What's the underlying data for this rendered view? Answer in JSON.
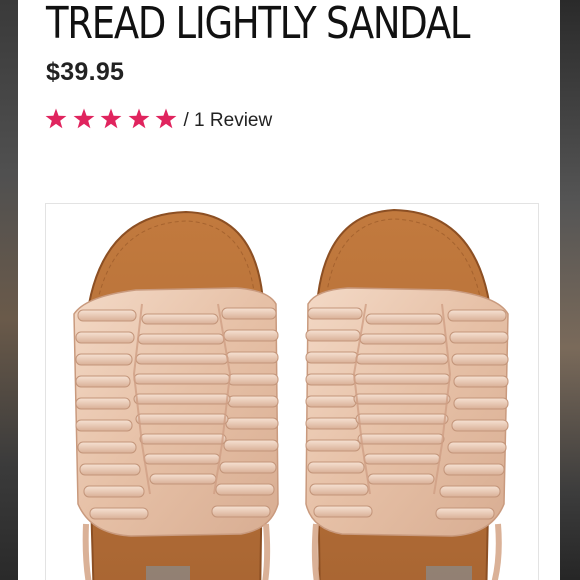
{
  "product": {
    "title": "TREAD LIGHTLY SANDAL",
    "price": "$39.95",
    "rating": {
      "stars": 5,
      "max_stars": 5,
      "star_color": "#e0245e",
      "review_text": "/ 1 Review"
    },
    "image": {
      "subject": "pair of rose gold woven slide sandals",
      "strap_color": "#e9c6b0",
      "footbed_color": "#b57038"
    }
  }
}
